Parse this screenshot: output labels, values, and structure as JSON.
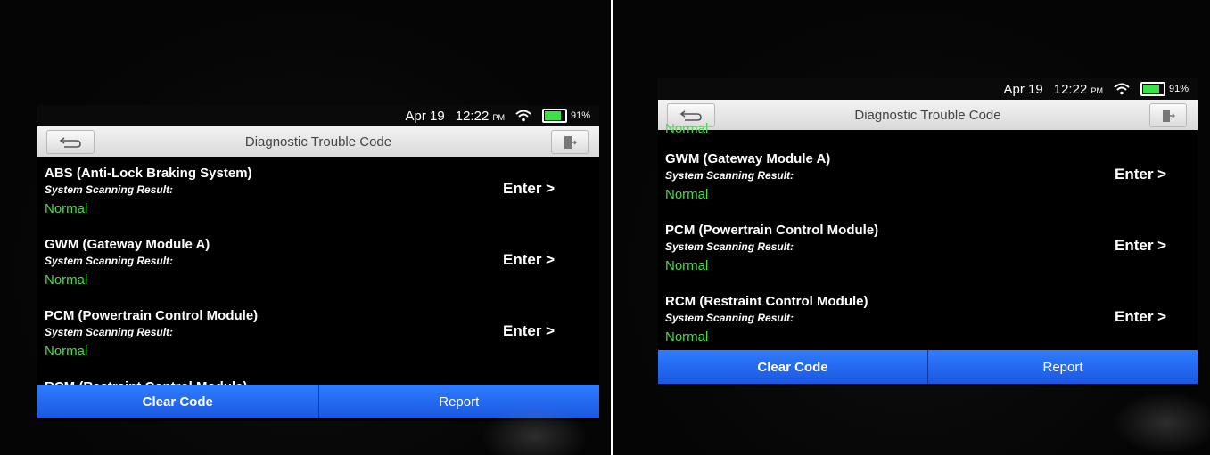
{
  "status_bar": {
    "date": "Apr 19",
    "time": "12:22",
    "ampm": "PM",
    "battery": "91%",
    "battery_level": 0.91
  },
  "header": {
    "title": "Diagnostic Trouble Code"
  },
  "left_screen": {
    "items": [
      {
        "name": "ABS (Anti-Lock Braking System)",
        "label": "System Scanning Result:",
        "status": "Normal",
        "enter": "Enter >"
      },
      {
        "name": "GWM (Gateway Module A)",
        "label": "System Scanning Result:",
        "status": "Normal",
        "enter": "Enter >"
      },
      {
        "name": "PCM (Powertrain Control Module)",
        "label": "System Scanning Result:",
        "status": "Normal",
        "enter": "Enter >"
      },
      {
        "name": "RCM (Restraint Control Module)"
      }
    ]
  },
  "right_screen": {
    "top_status": "Normal",
    "items": [
      {
        "name": "GWM (Gateway Module A)",
        "label": "System Scanning Result:",
        "status": "Normal",
        "enter": "Enter >"
      },
      {
        "name": "PCM (Powertrain Control Module)",
        "label": "System Scanning Result:",
        "status": "Normal",
        "enter": "Enter >"
      },
      {
        "name": "RCM (Restraint Control Module)",
        "label": "System Scanning Result:",
        "status": "Normal",
        "enter": "Enter >"
      }
    ]
  },
  "footer": {
    "clear_code": "Clear Code",
    "report": "Report"
  },
  "icons": {
    "back": "back-arrow-icon",
    "exit": "exit-door-icon",
    "wifi": "wifi-icon",
    "battery": "battery-icon"
  },
  "colors": {
    "status_green": "#4cd84a",
    "button_blue": "#1f63f0",
    "battery_green": "#3ee04a"
  }
}
